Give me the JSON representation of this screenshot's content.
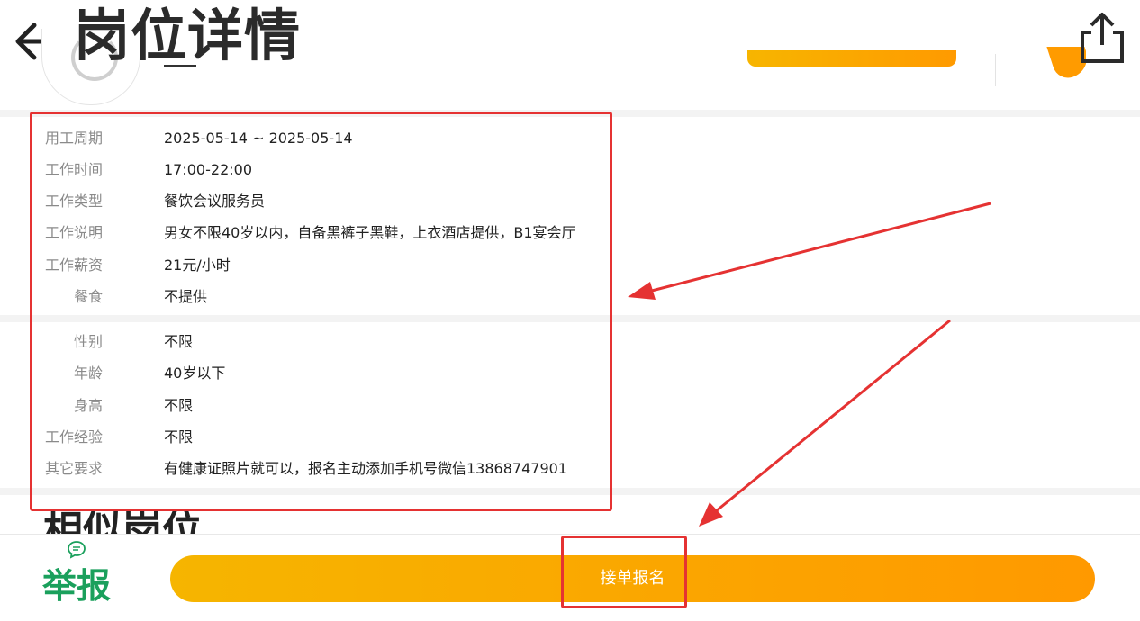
{
  "header": {
    "title": "岗位详情",
    "back_icon": "arrow-left-icon",
    "share_icon": "share-icon"
  },
  "job_info": [
    {
      "label": "用工周期",
      "value": "2025-05-14 ~ 2025-05-14"
    },
    {
      "label": "工作时间",
      "value": "17:00-22:00"
    },
    {
      "label": "工作类型",
      "value": "餐饮会议服务员"
    },
    {
      "label": "工作说明",
      "value": "男女不限40岁以内，自备黑裤子黑鞋，上衣酒店提供，B1宴会厅"
    },
    {
      "label": "工作薪资",
      "value": "21元/小时"
    },
    {
      "label": "餐食",
      "value": "不提供"
    }
  ],
  "requirements": [
    {
      "label": "性别",
      "value": "不限"
    },
    {
      "label": "年龄",
      "value": "40岁以下"
    },
    {
      "label": "身高",
      "value": "不限"
    },
    {
      "label": "工作经验",
      "value": "不限"
    },
    {
      "label": "其它要求",
      "value": "有健康证照片就可以，报名主动添加手机号微信13868747901"
    }
  ],
  "similar": {
    "title": "相似岗位"
  },
  "bottom_bar": {
    "report_label": "举报",
    "report_icon": "chat-bubble-icon",
    "apply_label": "接单报名"
  },
  "colors": {
    "accent_orange": "#ff9900",
    "accent_yellow": "#f6b500",
    "report_green": "#1aa05c",
    "annotation_red": "#e53232"
  }
}
